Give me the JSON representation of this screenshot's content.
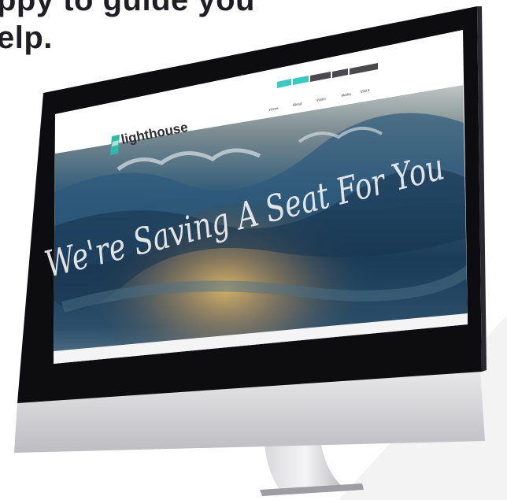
{
  "headline": {
    "line1": "ppy to guide you",
    "line2": "elp."
  },
  "website": {
    "logo_text": "lighthouse",
    "hero_text": "We're Saving A Seat For You",
    "nav_items": [
      "Home",
      "About",
      "Visitor",
      "Media",
      "Visit ▾"
    ],
    "top_bar": [
      "—",
      "—",
      "—",
      "—",
      "—"
    ]
  },
  "colors": {
    "accent_teal": "#3cc8c0",
    "logo_green": "#32b8a8",
    "sea_dark": "#1d3f5c",
    "bezel": "#111111",
    "chin": "#cfcfd3"
  }
}
